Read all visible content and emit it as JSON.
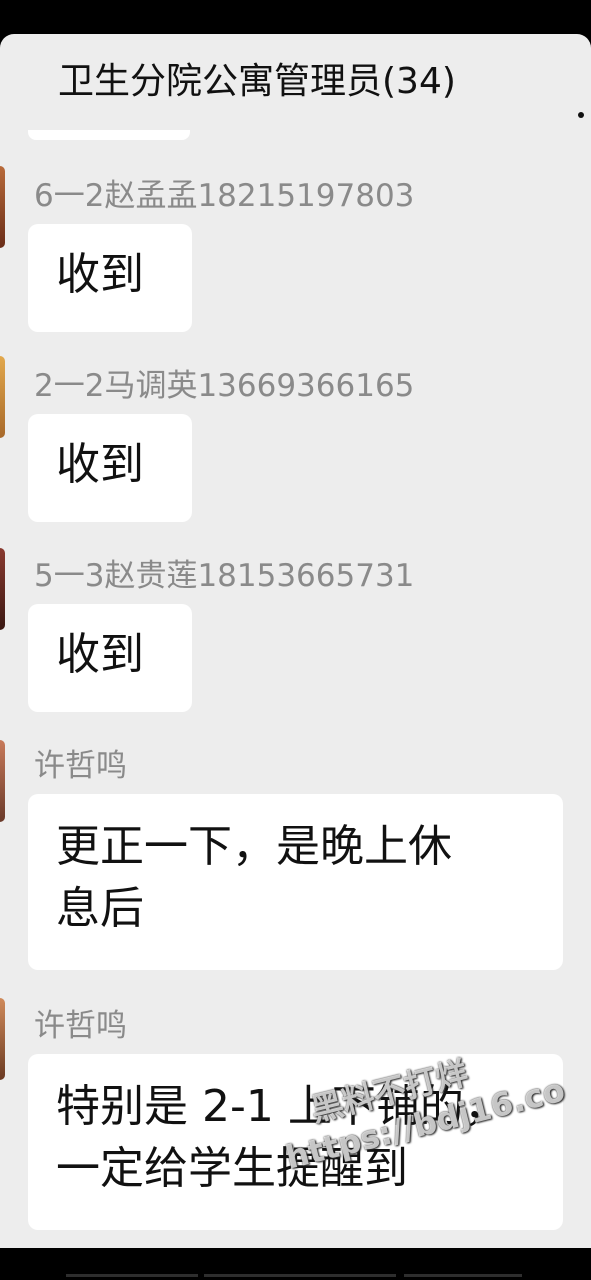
{
  "header": {
    "title": "卫生分院公寓管理员(34)"
  },
  "messages": [
    {
      "sender": "6一2赵孟孟18215197803",
      "lines": [
        "收到"
      ]
    },
    {
      "sender": "2一2马调英13669366165",
      "lines": [
        "收到"
      ]
    },
    {
      "sender": "5一3赵贵莲18153665731",
      "lines": [
        "收到"
      ]
    },
    {
      "sender": "许哲鸣",
      "lines": [
        "更正一下，是晚上休",
        "息后"
      ]
    },
    {
      "sender": "许哲鸣",
      "lines": [
        "特别是 2-1 上下铺的，",
        "一定给学生提醒到"
      ]
    }
  ],
  "watermark": {
    "line1": "黑料不打烊",
    "line2": "https://bdj16.co"
  },
  "colors": {
    "chat_background": "#ededed",
    "bubble": "#ffffff",
    "sender_text": "#8a8a8a",
    "message_text": "#111111"
  }
}
